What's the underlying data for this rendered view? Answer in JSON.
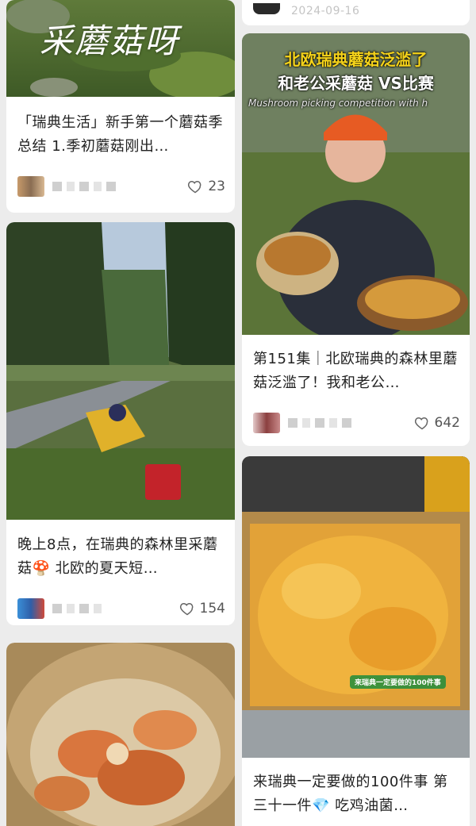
{
  "left_column": {
    "card1": {
      "overlay_text": "采蘑菇呀",
      "title": "「瑞典生活」新手第一个蘑菇季总结 1.季初蘑菇刚出…",
      "likes": "23"
    },
    "card2": {
      "title": "晚上8点，在瑞典的森林里采蘑菇🍄 北欧的夏天短…",
      "likes": "154"
    }
  },
  "right_column": {
    "top_date": "2024-09-16",
    "card1": {
      "overlay_line1": "北欧瑞典蘑菇泛滥了",
      "overlay_line2": "和老公采蘑菇 VS比赛",
      "overlay_subtitle": "Mushroom picking competition with h",
      "title": "第151集｜北欧瑞典的森林里蘑菇泛滥了！我和老公…",
      "likes": "642"
    },
    "card2": {
      "sticker_text": "来瑞典一定要做的100件事",
      "title": "来瑞典一定要做的100件事 第三十一件💎 吃鸡油菌…"
    }
  },
  "colors": {
    "accent_yellow": "#f5d31a",
    "text": "#222222",
    "muted": "#555555"
  }
}
